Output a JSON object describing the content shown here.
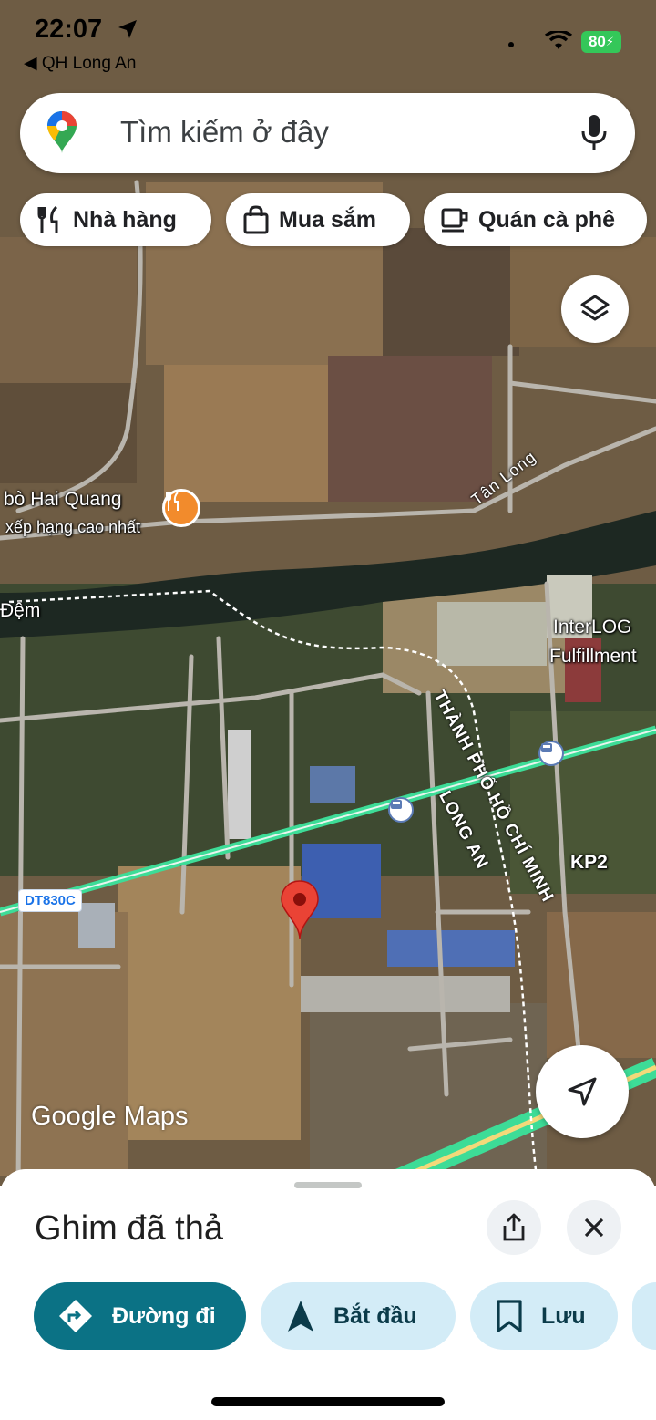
{
  "status_bar": {
    "time": "22:07",
    "back_app": "◀ QH Long An",
    "battery": "80"
  },
  "search": {
    "placeholder": "Tìm kiếm ở đây"
  },
  "chips": [
    {
      "label": "Nhà hàng",
      "icon": "fork-knife-icon"
    },
    {
      "label": "Mua sắm",
      "icon": "shopping-bag-icon"
    },
    {
      "label": "Quán cà phê",
      "icon": "coffee-cup-icon"
    }
  ],
  "map": {
    "place_name": "bò Hai Quang",
    "place_sub": "xếp hạng cao nhất",
    "tan_long": "Tân Long",
    "dem": "Đệm",
    "interlog_1": "InterLOG",
    "interlog_2": "Fulfillment",
    "city_boundary": "THÀNH PHỐ HỒ CHÍ MINH",
    "long_an": "LONG AN",
    "kp2": "KP2",
    "route_shield": "DT830C",
    "attribution": "Google Maps"
  },
  "sheet": {
    "title": "Ghim đã thả",
    "actions": [
      {
        "label": "Đường đi",
        "icon": "directions-icon"
      },
      {
        "label": "Bắt đầu",
        "icon": "navigation-arrow-icon"
      },
      {
        "label": "Lưu",
        "icon": "bookmark-icon"
      }
    ]
  },
  "colors": {
    "accent": "#0b7285",
    "chip_light": "#d3ecf7",
    "pin": "#ea4335",
    "highway": "#3ddc97"
  }
}
